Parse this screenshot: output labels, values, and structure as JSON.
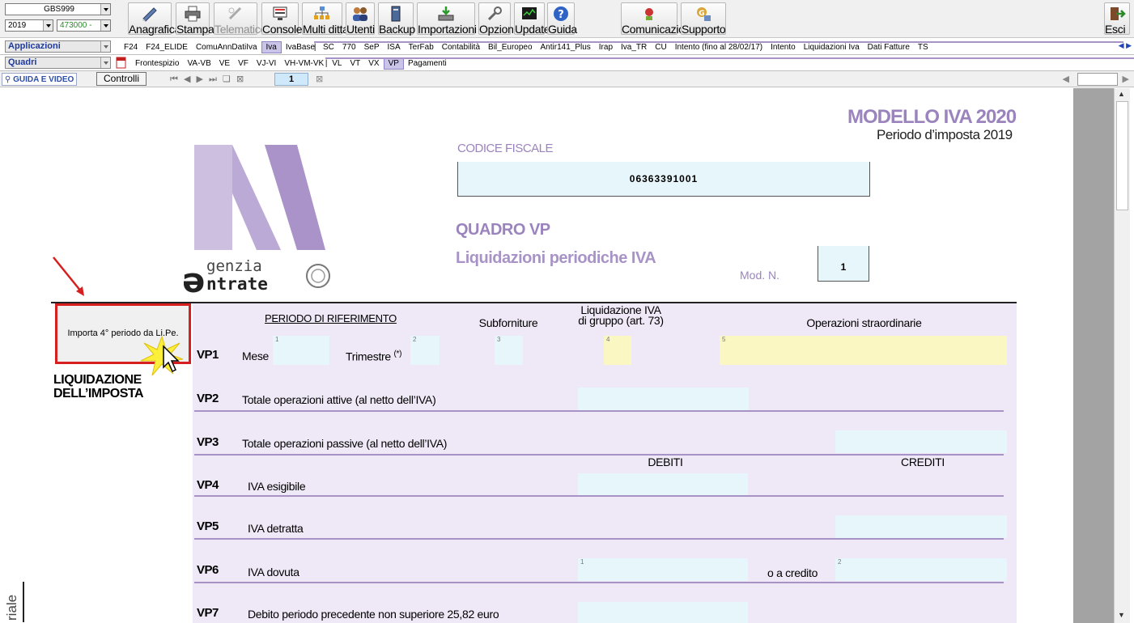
{
  "toolbar": {
    "company_code": "GBS999",
    "year": "2019",
    "ditta_code": "473000 -",
    "buttons": [
      {
        "label": "Anagrafica",
        "icon": "pen-icon"
      },
      {
        "label": "Stampa",
        "icon": "printer-icon"
      },
      {
        "label": "Telematico",
        "icon": "telematico-icon"
      },
      {
        "label": "Console",
        "icon": "console-icon"
      },
      {
        "label": "Multi ditta",
        "icon": "multi-ditta-icon"
      },
      {
        "label": "Utenti",
        "icon": "users-icon"
      },
      {
        "label": "Backup",
        "icon": "backup-icon"
      },
      {
        "label": "Importazioni",
        "icon": "import-icon"
      },
      {
        "label": "Opzioni",
        "icon": "wrench-icon"
      },
      {
        "label": "Update",
        "icon": "update-icon"
      },
      {
        "label": "Guida",
        "icon": "help-icon"
      },
      {
        "label": "Comunicazioni",
        "icon": "comunicazioni-icon"
      },
      {
        "label": "Supporto",
        "icon": "support-icon"
      }
    ],
    "exit_label": "Esci"
  },
  "applicazioni": {
    "label": "Applicazioni",
    "tabs": [
      "F24",
      "F24_ELIDE",
      "ComuAnnDatiIva",
      "Iva",
      "IvaBase",
      "SC",
      "770",
      "SeP",
      "ISA",
      "TerFab",
      "Contabilità",
      "Bil_Europeo",
      "Antir141_Plus",
      "Irap",
      "Iva_TR",
      "CU",
      "Intento (fino al 28/02/17)",
      "Intento",
      "Liquidazioni Iva",
      "Dati Fatture",
      "TS"
    ],
    "active": "Iva"
  },
  "quadri": {
    "label": "Quadri",
    "tabs": [
      "Frontespizio",
      "VA-VB",
      "VE",
      "VF",
      "VJ-VI",
      "VH-VM-VK",
      "VL",
      "VT",
      "VX",
      "VP",
      "Pagamenti"
    ],
    "active": "VP"
  },
  "nav": {
    "guida_label": "GUIDA E VIDEO",
    "controlli_label": "Controlli",
    "page": "1"
  },
  "doc": {
    "modello_title": "MODELLO IVA 2020",
    "periodo_imposta": "Periodo d’imposta 2019",
    "codice_fiscale_label": "CODICE FISCALE",
    "codice_fiscale": "06363391001",
    "quadro_title": "QUADRO VP",
    "quadro_subtitle": "Liquidazioni periodiche IVA",
    "mod_n_label": "Mod. N.",
    "mod_n": "1",
    "logo_text_1": "genzia",
    "logo_text_2": "ntrate",
    "import_button": "Importa 4° periodo da Li.Pe.",
    "section_title_1": "LIQUIDAZIONE",
    "section_title_2": "DELL’IMPOSTA",
    "side_text": "riale",
    "headers": {
      "periodo": "PERIODO DI RIFERIMENTO",
      "subforniture": "Subforniture",
      "liq_gruppo_1": "Liquidazione IVA",
      "liq_gruppo_2": "di gruppo (art. 73)",
      "operazioni": "Operazioni straordinarie",
      "debiti": "DEBITI",
      "crediti": "CREDITI"
    },
    "rows": {
      "vp1": {
        "code": "VP1",
        "mese": "Mese",
        "trimestre": "Trimestre",
        "trimestre_note": "(*)"
      },
      "vp2": {
        "code": "VP2",
        "label": "Totale operazioni attive (al netto dell’IVA)"
      },
      "vp3": {
        "code": "VP3",
        "label": "Totale operazioni passive (al netto dell’IVA)"
      },
      "vp4": {
        "code": "VP4",
        "label": "IVA esigibile"
      },
      "vp5": {
        "code": "VP5",
        "label": "IVA detratta"
      },
      "vp6": {
        "code": "VP6",
        "label": "IVA dovuta",
        "credito": "o a credito"
      },
      "vp7": {
        "code": "VP7",
        "label": "Debito periodo precedente non superiore 25,82 euro"
      }
    },
    "field_numbers": [
      "1",
      "2",
      "3",
      "4",
      "5"
    ]
  },
  "colors": {
    "accent_purple": "#9b84bd",
    "form_bg": "#efe8f6",
    "field_bg": "#e6f6fb",
    "field_yellow": "#fbf7c2",
    "highlight_red": "#d62020"
  }
}
